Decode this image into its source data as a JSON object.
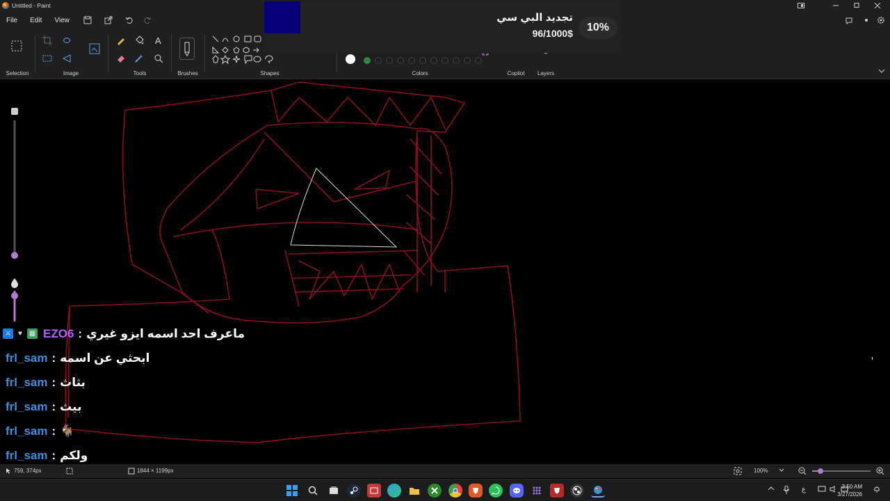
{
  "window": {
    "title": "Untitled - Paint",
    "controls": [
      "minimize",
      "maximize",
      "close"
    ]
  },
  "menu": {
    "file": "File",
    "edit": "Edit",
    "view": "View"
  },
  "ribbon": {
    "groups": {
      "selection": "Selection",
      "image": "Image",
      "tools": "Tools",
      "brushes": "Brushes",
      "shapes": "Shapes",
      "colors": "Colors",
      "copilot": "Copilot",
      "layers": "Layers"
    },
    "primary_color": "#7a0a12",
    "secondary_color": "#ffffff",
    "palette_row1": [
      "#000000",
      "#4b4b4b",
      "#8b1a1a",
      "#b32525",
      "#c7602a",
      "#b89a1e",
      "#6e9a2a",
      "#2a8a3a",
      "#2a7a9a",
      "#3a4ab0",
      "#7a3aa8"
    ],
    "palette_row2": [
      "#8a8a8a",
      "#a0a0a0",
      "#a06a6a",
      "#c07a8a",
      "#c09a5a",
      "#b8b04a",
      "#8ab85a",
      "#5ab0a0",
      "#6a8ab0",
      "#8a7ab0",
      "#a07ab0"
    ]
  },
  "overlay": {
    "title": "تجديد البي سي",
    "progress_text": "96/1000$",
    "percent": "10%",
    "progress_fraction": 0.096
  },
  "chat": [
    {
      "user": "EZO6",
      "message": "ماعرف احد اسمه ايزو غيري",
      "user_color": "#b060ff"
    },
    {
      "user": "frl_sam",
      "message": "ابحثي عن اسمه"
    },
    {
      "user": "frl_sam",
      "message": "بثاث"
    },
    {
      "user": "frl_sam",
      "message": "بيث"
    },
    {
      "user": "frl_sam",
      "message": "🐐"
    },
    {
      "user": "frl_sam",
      "message": "ولكم"
    }
  ],
  "status": {
    "cursor_pos": "759, 374px",
    "canvas_size": "1844 × 1199px",
    "zoom": "100%"
  },
  "taskbar": {
    "time": "3:50 AM",
    "date": "3/27/2026",
    "lang": "ع"
  }
}
